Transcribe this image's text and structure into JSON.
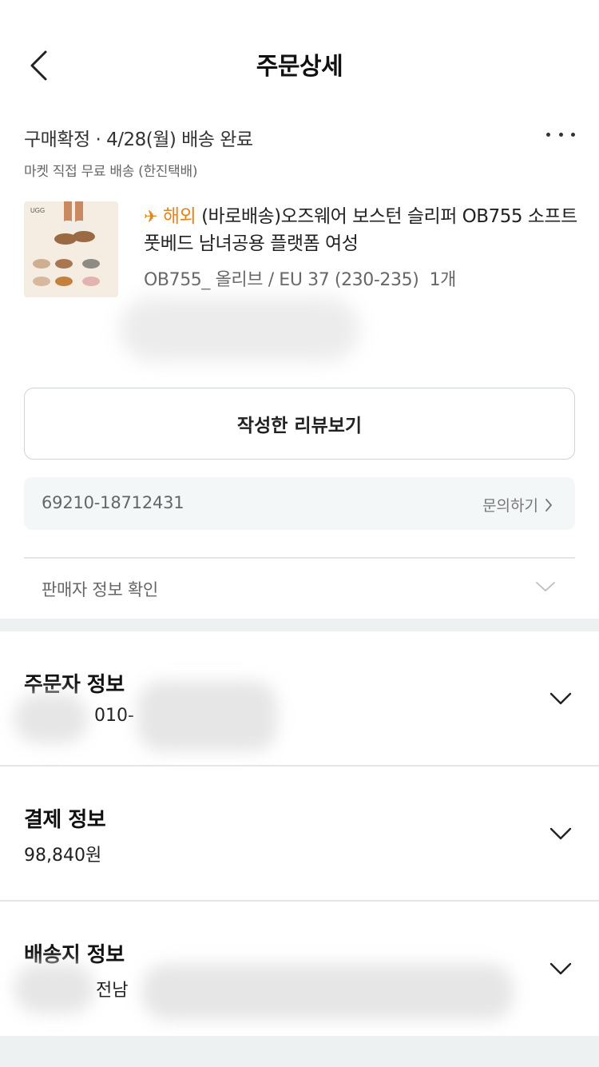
{
  "header": {
    "title": "주문상세",
    "back_icon": "chevron-left-icon"
  },
  "order": {
    "status": "구매확정 · 4/28(월) 배송 완료",
    "shipping": "마켓 직접 무료 배송 (한진택배)",
    "more_icon": "more-icon"
  },
  "product": {
    "badge_icon": "airplane-icon",
    "badge_label": "해외",
    "name": "(바로배송)오즈웨어 보스턴 슬리퍼 OB755 소프트 풋베드 남녀공용 플랫폼 여성",
    "option": "OB755_ 올리브 / EU 37 (230-235)",
    "quantity": "1개",
    "image_logo": "UGG"
  },
  "actions": {
    "review_label": "작성한 리뷰보기"
  },
  "order_box": {
    "order_number": "69210-18712431",
    "inquiry_label": "문의하기"
  },
  "seller": {
    "label": "판매자 정보 확인"
  },
  "sections": {
    "orderer": {
      "title": "주문자 정보",
      "value": "010-"
    },
    "payment": {
      "title": "결제 정보",
      "value": "98,840원"
    },
    "delivery": {
      "title": "배송지 정보",
      "value": "전남 "
    }
  },
  "colors": {
    "accent": "#e0861a",
    "section_gap": "#edf1f2",
    "order_box_bg": "#f4f7f8"
  }
}
